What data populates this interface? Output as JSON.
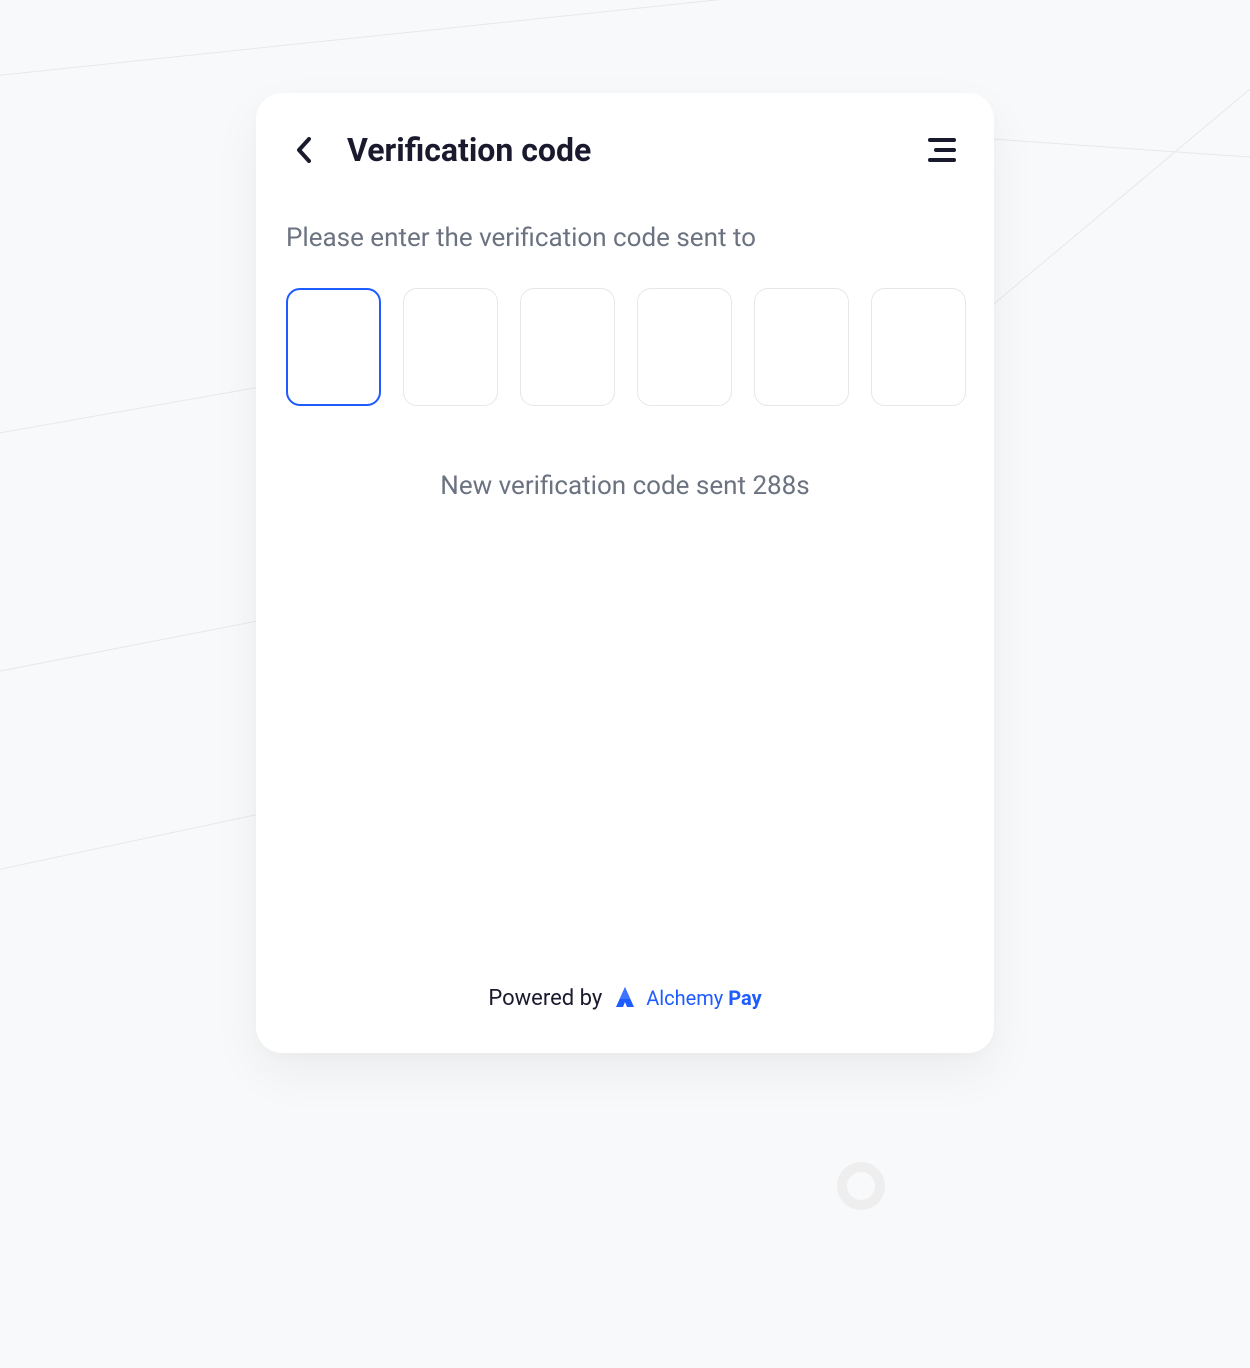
{
  "header": {
    "title": "Verification code"
  },
  "content": {
    "instruction": "Please enter the verification code sent to",
    "code_digits": [
      "",
      "",
      "",
      "",
      "",
      ""
    ],
    "active_index": 0,
    "timer_prefix": "New verification code sent ",
    "timer_seconds": "288",
    "timer_suffix": "s"
  },
  "footer": {
    "powered_by": "Powered by",
    "brand_name": "Alchemy",
    "brand_suffix": "Pay"
  },
  "colors": {
    "primary": "#1e5cff",
    "text_dark": "#1a1a2e",
    "text_muted": "#6b7280",
    "border": "#e5e7eb",
    "background": "#f8f9fa",
    "card_bg": "#ffffff"
  }
}
